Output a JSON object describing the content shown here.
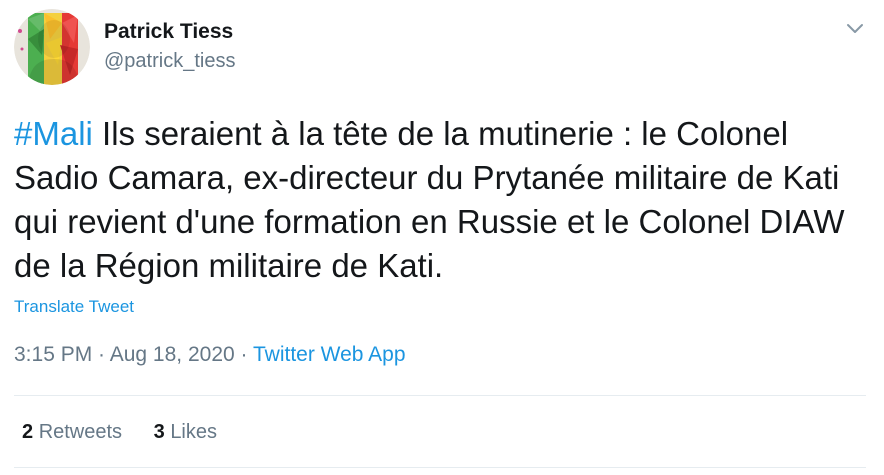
{
  "author": {
    "name": "Patrick Tiess",
    "handle": "@patrick_tiess"
  },
  "tweet": {
    "hashtag": "#Mali",
    "text": " Ils seraient à la tête de la mutinerie : le Colonel Sadio Camara, ex-directeur du Prytanée militaire de Kati qui revient d'une formation en Russie et le Colonel DIAW de la Région militaire de Kati."
  },
  "translate_label": "Translate Tweet",
  "meta": {
    "time": "3:15 PM",
    "sep1": " · ",
    "date": "Aug 18, 2020",
    "sep2": " · ",
    "source": "Twitter Web App"
  },
  "stats": {
    "retweets_count": "2",
    "retweets_label": "Retweets",
    "likes_count": "3",
    "likes_label": "Likes"
  },
  "icons": {
    "menu": "chevron-down-icon"
  },
  "colors": {
    "link": "#1b95e0",
    "secondary": "#657786",
    "primary_text": "#14171a",
    "divider": "#e6ecf0"
  }
}
